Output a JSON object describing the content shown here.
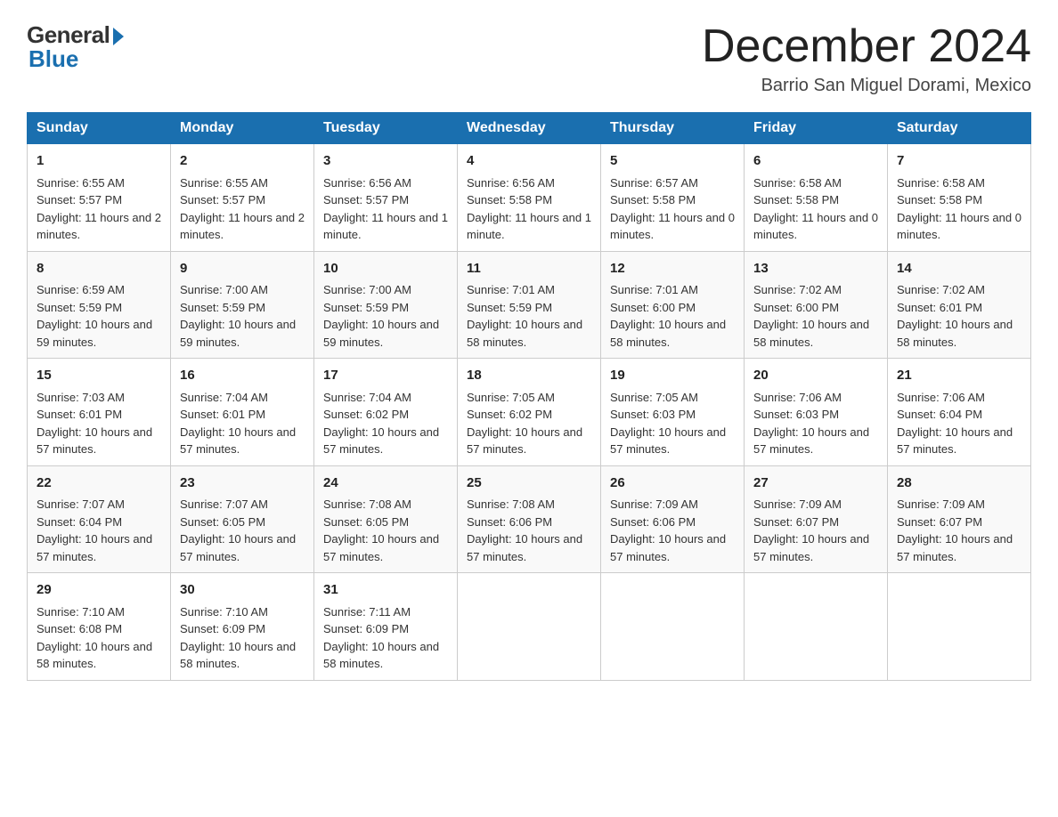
{
  "logo": {
    "general": "General",
    "blue": "Blue"
  },
  "title": "December 2024",
  "location": "Barrio San Miguel Dorami, Mexico",
  "days_of_week": [
    "Sunday",
    "Monday",
    "Tuesday",
    "Wednesday",
    "Thursday",
    "Friday",
    "Saturday"
  ],
  "weeks": [
    [
      {
        "day": "1",
        "sunrise": "6:55 AM",
        "sunset": "5:57 PM",
        "daylight": "11 hours and 2 minutes."
      },
      {
        "day": "2",
        "sunrise": "6:55 AM",
        "sunset": "5:57 PM",
        "daylight": "11 hours and 2 minutes."
      },
      {
        "day": "3",
        "sunrise": "6:56 AM",
        "sunset": "5:57 PM",
        "daylight": "11 hours and 1 minute."
      },
      {
        "day": "4",
        "sunrise": "6:56 AM",
        "sunset": "5:58 PM",
        "daylight": "11 hours and 1 minute."
      },
      {
        "day": "5",
        "sunrise": "6:57 AM",
        "sunset": "5:58 PM",
        "daylight": "11 hours and 0 minutes."
      },
      {
        "day": "6",
        "sunrise": "6:58 AM",
        "sunset": "5:58 PM",
        "daylight": "11 hours and 0 minutes."
      },
      {
        "day": "7",
        "sunrise": "6:58 AM",
        "sunset": "5:58 PM",
        "daylight": "11 hours and 0 minutes."
      }
    ],
    [
      {
        "day": "8",
        "sunrise": "6:59 AM",
        "sunset": "5:59 PM",
        "daylight": "10 hours and 59 minutes."
      },
      {
        "day": "9",
        "sunrise": "7:00 AM",
        "sunset": "5:59 PM",
        "daylight": "10 hours and 59 minutes."
      },
      {
        "day": "10",
        "sunrise": "7:00 AM",
        "sunset": "5:59 PM",
        "daylight": "10 hours and 59 minutes."
      },
      {
        "day": "11",
        "sunrise": "7:01 AM",
        "sunset": "5:59 PM",
        "daylight": "10 hours and 58 minutes."
      },
      {
        "day": "12",
        "sunrise": "7:01 AM",
        "sunset": "6:00 PM",
        "daylight": "10 hours and 58 minutes."
      },
      {
        "day": "13",
        "sunrise": "7:02 AM",
        "sunset": "6:00 PM",
        "daylight": "10 hours and 58 minutes."
      },
      {
        "day": "14",
        "sunrise": "7:02 AM",
        "sunset": "6:01 PM",
        "daylight": "10 hours and 58 minutes."
      }
    ],
    [
      {
        "day": "15",
        "sunrise": "7:03 AM",
        "sunset": "6:01 PM",
        "daylight": "10 hours and 57 minutes."
      },
      {
        "day": "16",
        "sunrise": "7:04 AM",
        "sunset": "6:01 PM",
        "daylight": "10 hours and 57 minutes."
      },
      {
        "day": "17",
        "sunrise": "7:04 AM",
        "sunset": "6:02 PM",
        "daylight": "10 hours and 57 minutes."
      },
      {
        "day": "18",
        "sunrise": "7:05 AM",
        "sunset": "6:02 PM",
        "daylight": "10 hours and 57 minutes."
      },
      {
        "day": "19",
        "sunrise": "7:05 AM",
        "sunset": "6:03 PM",
        "daylight": "10 hours and 57 minutes."
      },
      {
        "day": "20",
        "sunrise": "7:06 AM",
        "sunset": "6:03 PM",
        "daylight": "10 hours and 57 minutes."
      },
      {
        "day": "21",
        "sunrise": "7:06 AM",
        "sunset": "6:04 PM",
        "daylight": "10 hours and 57 minutes."
      }
    ],
    [
      {
        "day": "22",
        "sunrise": "7:07 AM",
        "sunset": "6:04 PM",
        "daylight": "10 hours and 57 minutes."
      },
      {
        "day": "23",
        "sunrise": "7:07 AM",
        "sunset": "6:05 PM",
        "daylight": "10 hours and 57 minutes."
      },
      {
        "day": "24",
        "sunrise": "7:08 AM",
        "sunset": "6:05 PM",
        "daylight": "10 hours and 57 minutes."
      },
      {
        "day": "25",
        "sunrise": "7:08 AM",
        "sunset": "6:06 PM",
        "daylight": "10 hours and 57 minutes."
      },
      {
        "day": "26",
        "sunrise": "7:09 AM",
        "sunset": "6:06 PM",
        "daylight": "10 hours and 57 minutes."
      },
      {
        "day": "27",
        "sunrise": "7:09 AM",
        "sunset": "6:07 PM",
        "daylight": "10 hours and 57 minutes."
      },
      {
        "day": "28",
        "sunrise": "7:09 AM",
        "sunset": "6:07 PM",
        "daylight": "10 hours and 57 minutes."
      }
    ],
    [
      {
        "day": "29",
        "sunrise": "7:10 AM",
        "sunset": "6:08 PM",
        "daylight": "10 hours and 58 minutes."
      },
      {
        "day": "30",
        "sunrise": "7:10 AM",
        "sunset": "6:09 PM",
        "daylight": "10 hours and 58 minutes."
      },
      {
        "day": "31",
        "sunrise": "7:11 AM",
        "sunset": "6:09 PM",
        "daylight": "10 hours and 58 minutes."
      },
      null,
      null,
      null,
      null
    ]
  ]
}
